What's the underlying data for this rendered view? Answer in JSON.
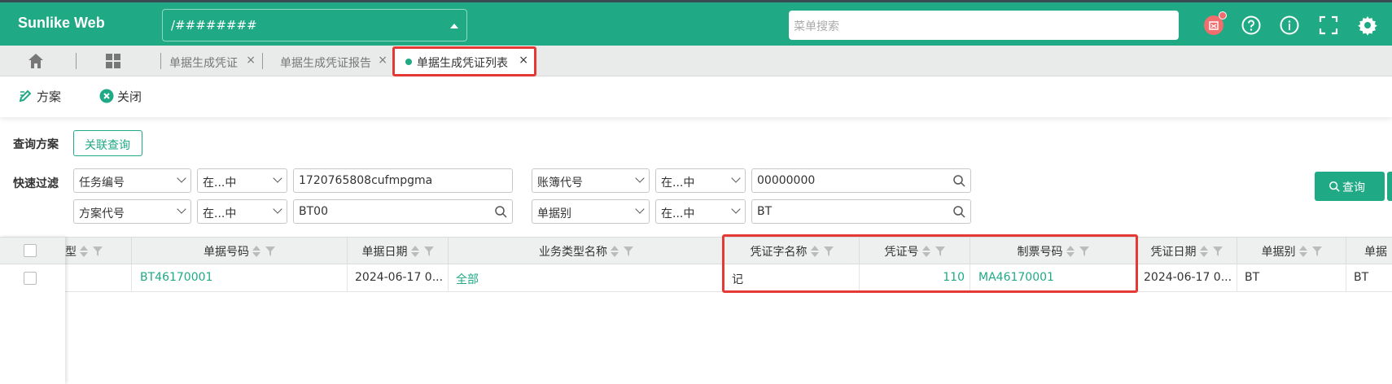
{
  "header": {
    "brand": "Sunlike Web",
    "org_value": "/########",
    "search_placeholder": "菜单搜索"
  },
  "tabs": {
    "items": [
      {
        "label": "单据生成凭证"
      },
      {
        "label": "单据生成凭证报告"
      },
      {
        "label": "单据生成凭证列表"
      }
    ]
  },
  "toolbar": {
    "plan_label": "方案",
    "close_label": "关闭"
  },
  "query": {
    "plan_label": "查询方案",
    "linked_query_label": "关联查询",
    "quick_filter_label": "快速过滤",
    "query_button_label": "查询",
    "filters": [
      {
        "field": "任务编号",
        "op": "在...中",
        "value": "1720765808cufmpgma"
      },
      {
        "field": "账簿代号",
        "op": "在...中",
        "value": "00000000"
      },
      {
        "field": "方案代号",
        "op": "在...中",
        "value": "BT00"
      },
      {
        "field": "单据别",
        "op": "在...中",
        "value": "BT"
      }
    ]
  },
  "grid": {
    "columns": [
      "型",
      "单据号码",
      "单据日期",
      "业务类型名称",
      "凭证字名称",
      "凭证号",
      "制票号码",
      "凭证日期",
      "单据别",
      "单据"
    ],
    "rows": [
      {
        "doc_no": "BT46170001",
        "doc_date": "2024-06-17 0...",
        "biz_type": "全部",
        "voucher_word": "记",
        "voucher_no": "110",
        "ticket_no": "MA46170001",
        "voucher_date": "2024-06-17 0...",
        "doc_type": "BT",
        "doc_type2": "BT"
      }
    ]
  },
  "colors": {
    "accent": "#1faa85",
    "highlight": "#e53935"
  }
}
